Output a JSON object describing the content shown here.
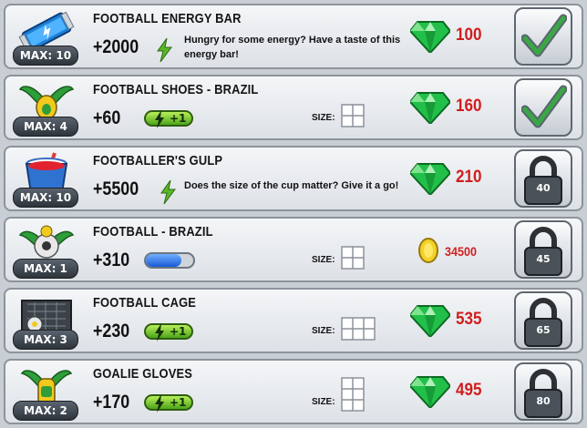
{
  "colors": {
    "gem": "#22c04a",
    "price": "#d01e1e",
    "energy": "#5ab52a"
  },
  "items": [
    {
      "name": "FOOTBALL ENERGY BAR",
      "max": "MAX: 10",
      "power": "+2000",
      "desc": "Hungry for some energy? Have a taste of this energy bar!",
      "price": "100",
      "currency": "gem-icon",
      "action": "check",
      "icon": "energy-bar-icon"
    },
    {
      "name": "FOOTBALL SHOES - BRAZIL",
      "max": "MAX: 4",
      "power": "+60",
      "energy": "+1",
      "size_label": "SIZE:",
      "price": "160",
      "currency": "gem-icon",
      "action": "check",
      "icon": "winged-shoes-icon"
    },
    {
      "name": "FOOTBALLER'S GULP",
      "max": "MAX: 10",
      "power": "+5500",
      "desc": "Does the size of the cup matter? Give it a go!",
      "price": "210",
      "currency": "gem-icon",
      "action": "lock",
      "lock_level": "40",
      "icon": "drink-cup-icon"
    },
    {
      "name": "FOOTBALL - BRAZIL",
      "max": "MAX: 1",
      "power": "+310",
      "size_label": "SIZE:",
      "price": "34500",
      "currency": "coin-icon",
      "action": "lock",
      "lock_level": "45",
      "icon": "winged-ball-icon",
      "progress": 0.75
    },
    {
      "name": "FOOTBALL CAGE",
      "max": "MAX: 3",
      "power": "+230",
      "energy": "+1",
      "size_label": "SIZE:",
      "price": "535",
      "currency": "gem-icon",
      "action": "lock",
      "lock_level": "65",
      "icon": "football-cage-icon"
    },
    {
      "name": "GOALIE GLOVES",
      "max": "MAX: 2",
      "power": "+170",
      "energy": "+1",
      "size_label": "SIZE:",
      "price": "495",
      "currency": "gem-icon",
      "action": "lock",
      "lock_level": "80",
      "icon": "goalie-gloves-icon"
    }
  ]
}
